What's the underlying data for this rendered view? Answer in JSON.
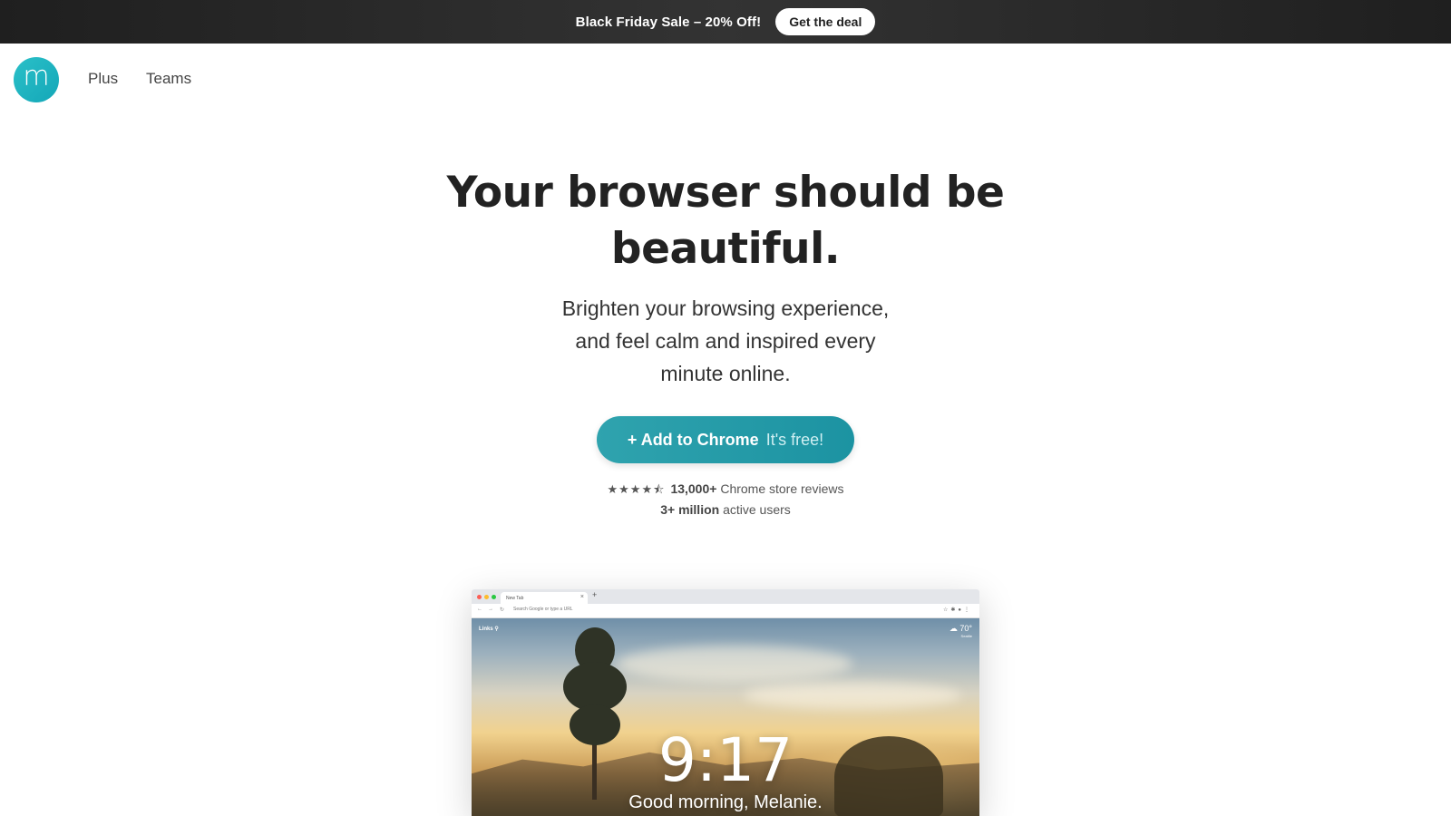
{
  "promo": {
    "text": "Black Friday Sale – 20% Off!",
    "button_label": "Get the deal"
  },
  "nav": {
    "logo_letter": "m",
    "links": [
      "Plus",
      "Teams"
    ]
  },
  "hero": {
    "title_line1": "Your browser should be",
    "title_line2": "beautiful.",
    "subtitle_line1": "Brighten your browsing experience,",
    "subtitle_line2": "and feel calm and inspired every",
    "subtitle_line3": "minute online.",
    "cta_main": "+ Add to Chrome",
    "cta_free": "It's free!"
  },
  "social_proof": {
    "rating_stars": 4.5,
    "review_count": "13,000+",
    "review_label": "Chrome store reviews",
    "users_count": "3+ million",
    "users_label": "active users"
  },
  "preview": {
    "tab_title": "New Tab",
    "tab_close": "×",
    "new_tab": "+",
    "omnibox_placeholder": "Search Google or type a URL",
    "links_label": "Links",
    "temperature": "70°",
    "location": "Seattle",
    "time": "9:17",
    "greeting": "Good morning, Melanie."
  },
  "colors": {
    "accent": "#1f9aa8",
    "logo": "#1cb3c0",
    "banner": "#2a2a2a"
  }
}
